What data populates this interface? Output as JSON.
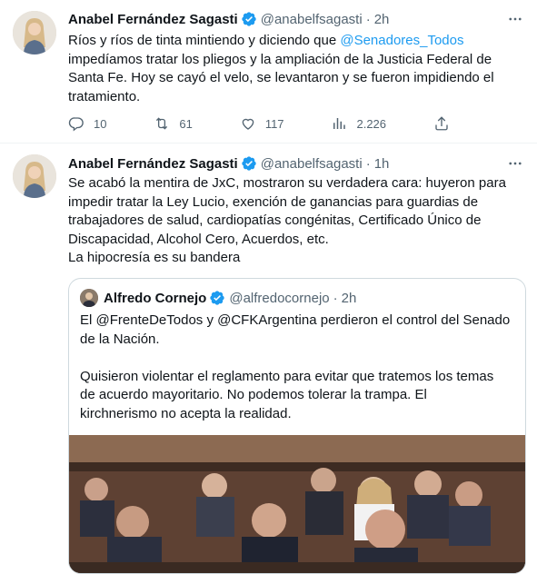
{
  "tweets": [
    {
      "author_name": "Anabel Fernández Sagasti",
      "handle": "@anabelfsagasti",
      "separator": "·",
      "time": "2h",
      "text_before": "Ríos y ríos de tinta mintiendo y diciendo que ",
      "mention": "@Senadores_Todos",
      "text_after": "\nimpedíamos tratar los pliegos y la ampliación de la Justicia Federal de\nSanta Fe. Hoy se cayó el velo, se levantaron y se fueron impidiendo el\ntratamiento.",
      "replies": "10",
      "retweets": "61",
      "likes": "117",
      "views": "2.226"
    },
    {
      "author_name": "Anabel Fernández Sagasti",
      "handle": "@anabelfsagasti",
      "separator": "·",
      "time": "1h",
      "text": "Se acabó la mentira de JxC, mostraron su verdadera cara: huyeron para\nimpedir tratar la Ley Lucio, exención de ganancias para guardias de\ntrabajadores de salud, cardiopatías congénitas, Certificado Único de\nDiscapacidad, Alcohol Cero, Acuerdos, etc.\nLa hipocresía es su bandera",
      "quote": {
        "author_name": "Alfredo Cornejo",
        "handle": "@alfredocornejo",
        "separator": "·",
        "time": "2h",
        "text": "El @FrenteDeTodos y @CFKArgentina perdieron el control del Senado\nde la Nación.\n\nQuisieron violentar el reglamento para evitar que tratemos los temas\nde acuerdo mayoritario. No podemos tolerar la trampa. El\nkirchnerismo no acepta la realidad."
      }
    }
  ],
  "colors": {
    "accent": "#1d9bf0",
    "secondary_text": "#536471",
    "border": "#cfd9de"
  },
  "icons": [
    "verified-badge-icon",
    "more-icon",
    "reply-icon",
    "retweet-icon",
    "like-icon",
    "views-icon",
    "share-icon"
  ]
}
